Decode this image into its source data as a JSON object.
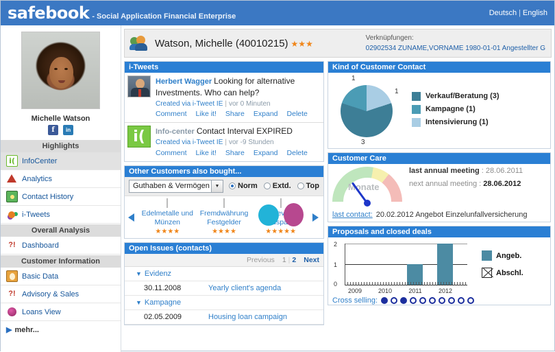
{
  "header": {
    "brand": "safebook",
    "tagline": "- Social Application Financial Enterprise",
    "lang_de": "Deutsch",
    "lang_sep": "|",
    "lang_en": "English"
  },
  "sidebar": {
    "customer_name": "Michelle Watson",
    "social": [
      {
        "name": "facebook",
        "glyph": "f"
      },
      {
        "name": "linkedin",
        "glyph": "in"
      }
    ],
    "groups": [
      {
        "title": "Highlights",
        "items": [
          {
            "label": "InfoCenter",
            "icon": "infocenter-icon",
            "active": true
          },
          {
            "label": "Analytics",
            "icon": "analytics-icon",
            "active": false
          },
          {
            "label": "Contact History",
            "icon": "contact-history-icon",
            "active": false
          },
          {
            "label": "i-Tweets",
            "icon": "i-tweets-icon",
            "active": false
          }
        ]
      },
      {
        "title": "Overall Analysis",
        "items": [
          {
            "label": "Dashboard",
            "icon": "dashboard-icon",
            "active": false
          }
        ]
      },
      {
        "title": "Customer Information",
        "items": [
          {
            "label": "Basic Data",
            "icon": "basic-data-icon",
            "active": false
          },
          {
            "label": "Advisory & Sales",
            "icon": "advisory-sales-icon",
            "active": false
          },
          {
            "label": "Loans View",
            "icon": "loans-view-icon",
            "active": false
          }
        ]
      }
    ],
    "more_label": "mehr...",
    "more_arrow": "▶"
  },
  "customer_bar": {
    "title": "Watson, Michelle (40010215)",
    "rating": "★★★",
    "links_label": "Verknüpfungen:",
    "links_value": "02902534 ZUNAME,VORNAME 1980-01-01 Angestellter G"
  },
  "tweets_panel": {
    "title": "i-Tweets",
    "items": [
      {
        "author": "Herbert Wagger",
        "author_grey": false,
        "text": "Looking for alternative Investments. Who can help?",
        "via": "Created via i-Tweet IE",
        "sep": "|",
        "ago": "vor 0 Minuten",
        "actions": [
          "Comment",
          "Like it!",
          "Share",
          "Expand",
          "Delete"
        ]
      },
      {
        "author": "Info-center",
        "author_grey": true,
        "text": "Contact Interval EXPIRED",
        "via": "Created via i-Tweet IE",
        "sep": "|",
        "ago": "vor -9 Stunden",
        "actions": [
          "Comment",
          "Like it!",
          "Share",
          "Expand",
          "Delete"
        ]
      }
    ]
  },
  "contact_panel": {
    "title": "Kind of Customer Contact"
  },
  "products_panel": {
    "title": "Other Customers also bought...",
    "category": "Guthaben & Vermögen",
    "dropdown_glyph": "▼",
    "radios": [
      {
        "label": "Norm",
        "selected": true
      },
      {
        "label": "Extd.",
        "selected": false
      },
      {
        "label": "Top",
        "selected": false
      }
    ],
    "prev_arrow": "prev",
    "next_arrow": "next",
    "items": [
      {
        "caption": "Edelmetalle und Münzen",
        "stars": "★★★★",
        "thumb": "t1"
      },
      {
        "caption": "Fremdwährung Festgelder",
        "stars": "★★★★",
        "thumb": "t2"
      },
      {
        "caption": "Clever Bausparen",
        "stars": "★★★★★",
        "thumb": "t3"
      }
    ]
  },
  "care_panel": {
    "title": "Customer Care",
    "gauge_label": "Monate",
    "last_meeting_key": "last annual meeting",
    "last_meeting_sep": ":",
    "last_meeting_val": "28.06.2011",
    "next_meeting_key": "next annual meeting",
    "next_meeting_sep": ":",
    "next_meeting_val": "28.06.2012",
    "last_contact_link": "last contact:",
    "last_contact_text": "20.02.2012 Angebot Einzelunfallversicherung"
  },
  "issues_panel": {
    "title": "Open Issues (contacts)",
    "pager": {
      "previous": "Previous",
      "pages": [
        "1",
        "2"
      ],
      "current": "2",
      "bar": "|",
      "next": "Next"
    },
    "groups": [
      {
        "name": "Evidenz",
        "tri": "▼",
        "rows": [
          {
            "date": "30.11.2008",
            "subject": "Yearly client's agenda"
          }
        ]
      },
      {
        "name": "Kampagne",
        "tri": "▼",
        "rows": [
          {
            "date": "02.05.2009",
            "subject": "Housing loan campaign"
          }
        ]
      }
    ]
  },
  "proposals_panel": {
    "title": "Proposals and closed deals",
    "cross_selling_label": "Cross selling:",
    "cross_selling_dots": [
      true,
      false,
      true,
      false,
      false,
      false,
      false,
      false,
      false,
      false
    ]
  },
  "chart_data": [
    {
      "type": "pie",
      "title": "Kind of Customer Contact",
      "labels": [
        "Intensivierung",
        "Verkauf/Beratung",
        "Kampagne"
      ],
      "values": [
        1,
        3,
        1
      ],
      "colors": [
        "#a9cde4",
        "#3d7e96",
        "#4b9cb5"
      ],
      "slice_labels": [
        "1",
        "3",
        "1"
      ],
      "legend": [
        {
          "name": "Verkauf/Beratung (3)",
          "color": "#3d7e96"
        },
        {
          "name": "Kampagne (1)",
          "color": "#4b9cb5"
        },
        {
          "name": "Intensivierung (1)",
          "color": "#a9cde4"
        }
      ],
      "legend_position": "right"
    },
    {
      "type": "bar",
      "title": "Proposals and closed deals",
      "categories": [
        "2009",
        "2010",
        "2011",
        "2012"
      ],
      "series": [
        {
          "name": "Angeb.",
          "values": [
            0,
            0,
            1,
            2
          ],
          "color": "#4c8ba3"
        },
        {
          "name": "Abschl.",
          "values": [
            0,
            0,
            0,
            0
          ],
          "color": "#ffffff"
        }
      ],
      "ylim": [
        0,
        2
      ],
      "yticks": [
        "0",
        "1",
        "2"
      ],
      "xlabel": "",
      "ylabel": "",
      "grid": true,
      "legend_position": "right"
    },
    {
      "type": "gauge",
      "title": "Customer Care",
      "unit_label": "Monate",
      "zones": [
        {
          "color": "#bfe6bd",
          "from": 0,
          "to": 100
        },
        {
          "color": "#f6f0ae",
          "from": 100,
          "to": 128
        },
        {
          "color": "#f4bcb8",
          "from": 128,
          "to": 180
        }
      ],
      "needle_angle_deg": -36
    }
  ]
}
